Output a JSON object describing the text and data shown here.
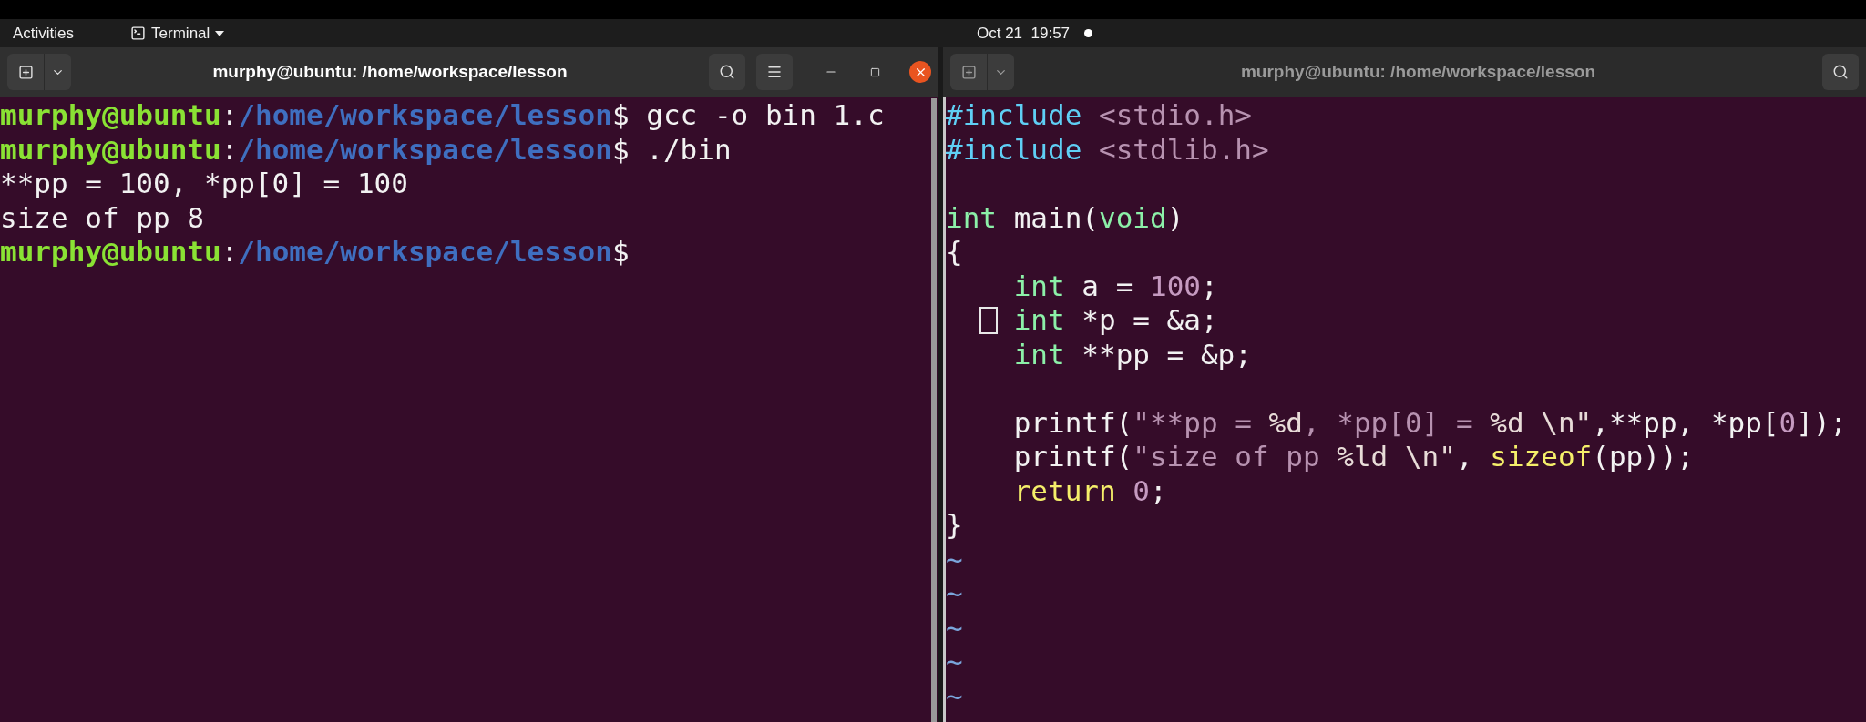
{
  "top_bar": {
    "activities": "Activities",
    "app_menu": "Terminal",
    "clock": "Oct 21  19:57",
    "notification": true
  },
  "windows": [
    {
      "kind": "terminal",
      "title": "murphy@ubuntu: /home/workspace/lesson",
      "active": true,
      "controls": [
        {
          "kind": "search"
        },
        {
          "kind": "menu"
        },
        {
          "kind": "minimize"
        },
        {
          "kind": "maximize"
        },
        {
          "kind": "close"
        }
      ],
      "lines": [
        {
          "kind": "code",
          "segments": [
            {
              "kind": "user",
              "text": "murphy@ubuntu"
            },
            {
              "kind": "plain",
              "text": ":"
            },
            {
              "kind": "path",
              "text": "/home/workspace/lesson"
            },
            {
              "kind": "plain",
              "text": "$ gcc -o bin 1.c"
            }
          ]
        },
        {
          "kind": "code",
          "segments": [
            {
              "kind": "user",
              "text": "murphy@ubuntu"
            },
            {
              "kind": "plain",
              "text": ":"
            },
            {
              "kind": "path",
              "text": "/home/workspace/lesson"
            },
            {
              "kind": "plain",
              "text": "$ ./bin"
            }
          ]
        },
        {
          "kind": "code",
          "segments": [
            {
              "kind": "plain",
              "text": "**pp = 100, *pp[0] = 100"
            }
          ]
        },
        {
          "kind": "code",
          "segments": [
            {
              "kind": "plain",
              "text": "size of pp 8"
            }
          ]
        },
        {
          "kind": "code",
          "segments": [
            {
              "kind": "user",
              "text": "murphy@ubuntu"
            },
            {
              "kind": "plain",
              "text": ":"
            },
            {
              "kind": "path",
              "text": "/home/workspace/lesson"
            },
            {
              "kind": "plain",
              "text": "$"
            }
          ]
        }
      ]
    },
    {
      "kind": "editor",
      "title": "murphy@ubuntu: /home/workspace/lesson",
      "active": false,
      "controls": [
        {
          "kind": "search"
        }
      ],
      "lines": [
        {
          "kind": "code",
          "segments": [
            {
              "kind": "preproc",
              "text": "#include "
            },
            {
              "kind": "string",
              "text": "<stdio.h>"
            }
          ]
        },
        {
          "kind": "code",
          "segments": [
            {
              "kind": "preproc",
              "text": "#include "
            },
            {
              "kind": "string",
              "text": "<stdlib.h>"
            }
          ]
        },
        {
          "kind": "blank"
        },
        {
          "kind": "code",
          "segments": [
            {
              "kind": "type",
              "text": "int"
            },
            {
              "kind": "plain",
              "text": " main("
            },
            {
              "kind": "type",
              "text": "void"
            },
            {
              "kind": "plain",
              "text": ")"
            }
          ]
        },
        {
          "kind": "code",
          "segments": [
            {
              "kind": "plain",
              "text": "{"
            }
          ]
        },
        {
          "kind": "code",
          "indent": true,
          "segments": [
            {
              "kind": "type",
              "text": "int"
            },
            {
              "kind": "plain",
              "text": " a = "
            },
            {
              "kind": "number",
              "text": "100"
            },
            {
              "kind": "plain",
              "text": ";"
            }
          ]
        },
        {
          "kind": "code",
          "indent": true,
          "cursor": true,
          "segments": [
            {
              "kind": "type",
              "text": "int"
            },
            {
              "kind": "plain",
              "text": " *p = &a;"
            }
          ]
        },
        {
          "kind": "code",
          "indent": true,
          "segments": [
            {
              "kind": "type",
              "text": "int"
            },
            {
              "kind": "plain",
              "text": " **pp = &p;"
            }
          ]
        },
        {
          "kind": "blank"
        },
        {
          "kind": "code",
          "indent": true,
          "segments": [
            {
              "kind": "plain",
              "text": "printf("
            },
            {
              "kind": "string",
              "text": "\"**pp = "
            },
            {
              "kind": "escape",
              "text": "%d"
            },
            {
              "kind": "string",
              "text": ", *pp[0] = "
            },
            {
              "kind": "escape",
              "text": "%d \\n\""
            },
            {
              "kind": "plain",
              "text": ",**pp, *pp["
            },
            {
              "kind": "number",
              "text": "0"
            },
            {
              "kind": "plain",
              "text": "]);"
            }
          ]
        },
        {
          "kind": "code",
          "indent": true,
          "segments": [
            {
              "kind": "plain",
              "text": "printf("
            },
            {
              "kind": "string",
              "text": "\"size of pp "
            },
            {
              "kind": "escape",
              "text": "%ld \\n\""
            },
            {
              "kind": "plain",
              "text": ", "
            },
            {
              "kind": "builtin",
              "text": "sizeof"
            },
            {
              "kind": "plain",
              "text": "(pp));"
            }
          ]
        },
        {
          "kind": "code",
          "indent": true,
          "segments": [
            {
              "kind": "builtin",
              "text": "return "
            },
            {
              "kind": "number",
              "text": "0"
            },
            {
              "kind": "plain",
              "text": ";"
            }
          ]
        },
        {
          "kind": "code",
          "segments": [
            {
              "kind": "plain",
              "text": "}"
            }
          ]
        },
        {
          "kind": "tilde",
          "text": "~"
        },
        {
          "kind": "tilde",
          "text": "~"
        },
        {
          "kind": "tilde",
          "text": "~"
        },
        {
          "kind": "tilde",
          "text": "~"
        },
        {
          "kind": "tilde",
          "text": "~"
        }
      ]
    }
  ]
}
